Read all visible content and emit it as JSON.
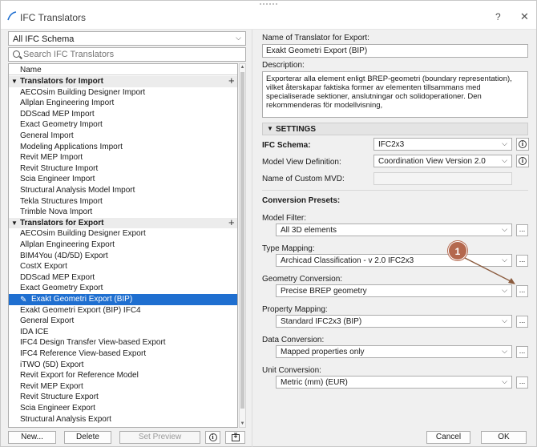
{
  "window": {
    "title": "IFC Translators",
    "help": "?",
    "close": "✕"
  },
  "left": {
    "schema_select": "All IFC Schema",
    "search_placeholder": "Search IFC Translators",
    "list_header": "Name",
    "groups": [
      {
        "label": "Translators for Import",
        "items": [
          "AECOsim Building Designer Import",
          "Allplan Engineering Import",
          "DDScad MEP Import",
          "Exact Geometry Import",
          "General Import",
          "Modeling Applications Import",
          "Revit MEP Import",
          "Revit Structure Import",
          "Scia Engineer Import",
          "Structural Analysis Model Import",
          "Tekla Structures Import",
          "Trimble Nova Import"
        ]
      },
      {
        "label": "Translators for Export",
        "items": [
          "AECOsim Building Designer Export",
          "Allplan Engineering Export",
          "BIM4You (4D/5D) Export",
          "CostX Export",
          "DDScad MEP Export",
          "Exact Geometry Export",
          "Exakt Geometri Export (BIP)",
          "Exakt Geometri Export (BIP) IFC4",
          "General Export",
          "IDA ICE",
          "IFC4 Design Transfer View-based Export",
          "IFC4 Reference View-based Export",
          "iTWO (5D) Export",
          "Revit Export for Reference Model",
          "Revit MEP Export",
          "Revit Structure Export",
          "Scia Engineer Export",
          "Structural Analysis Export"
        ]
      }
    ],
    "selected_item": "Exakt Geometri Export (BIP)",
    "buttons": {
      "new": "New...",
      "delete": "Delete",
      "preview": "Set Preview",
      "info": "i"
    }
  },
  "right": {
    "name_label": "Name of Translator for Export:",
    "name_value": "Exakt Geometri Export (BIP)",
    "description_label": "Description:",
    "description_text": "Exporterar alla element enligt BREP-geometri (boundary representation), vilket återskapar faktiska former av elementen tillsammans med specialiserade sektioner, anslutningar och solidoperationer. Den rekommenderas för modellvisning,",
    "settings_header": "SETTINGS",
    "ifc_schema_label": "IFC Schema:",
    "ifc_schema_value": "IFC2x3",
    "mvd_label": "Model View Definition:",
    "mvd_value": "Coordination View Version 2.0",
    "custom_mvd_label": "Name of Custom MVD:",
    "presets_label": "Conversion Presets:",
    "model_filter_label": "Model Filter:",
    "model_filter_value": "All 3D elements",
    "type_mapping_label": "Type Mapping:",
    "type_mapping_value": "Archicad Classification - v 2.0 IFC2x3",
    "geometry_label": "Geometry Conversion:",
    "geometry_value": "Precise BREP geometry",
    "property_label": "Property Mapping:",
    "property_value": "Standard IFC2x3 (BIP)",
    "data_label": "Data Conversion:",
    "data_value": "Mapped properties only",
    "unit_label": "Unit Conversion:",
    "unit_value": "Metric (mm) (EUR)",
    "dots": "...",
    "cancel": "Cancel",
    "ok": "OK"
  },
  "callout": {
    "number": "1",
    "color": "#b4684e"
  },
  "colors": {
    "selection": "#1f6fd0",
    "group_bg": "#ececec"
  }
}
